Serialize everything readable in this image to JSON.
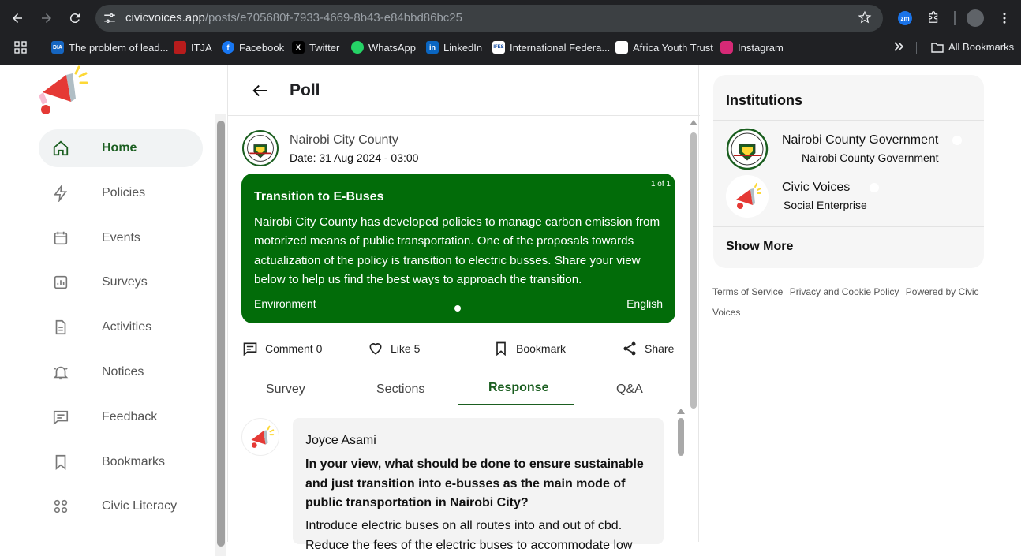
{
  "browser": {
    "url_host": "civicvoices.app",
    "url_path": "/posts/e705680f-7933-4669-8b43-e84bbd86bc25",
    "extension_zm": "zm",
    "bookmarks": [
      {
        "label": "The problem of lead...",
        "icon": "DIA"
      },
      {
        "label": "ITJA",
        "icon": ""
      },
      {
        "label": "Facebook",
        "icon": "f"
      },
      {
        "label": "Twitter",
        "icon": "X"
      },
      {
        "label": "WhatsApp",
        "icon": ""
      },
      {
        "label": "LinkedIn",
        "icon": "in"
      },
      {
        "label": "International Federa...",
        "icon": "IFES"
      },
      {
        "label": "Africa Youth Trust",
        "icon": ""
      },
      {
        "label": "Instagram",
        "icon": ""
      }
    ],
    "all_bookmarks": "All Bookmarks"
  },
  "sidebar": {
    "items": [
      {
        "label": "Home",
        "icon": "home-icon"
      },
      {
        "label": "Policies",
        "icon": "lightning-icon"
      },
      {
        "label": "Events",
        "icon": "calendar-icon"
      },
      {
        "label": "Surveys",
        "icon": "chart-icon"
      },
      {
        "label": "Activities",
        "icon": "document-icon"
      },
      {
        "label": "Notices",
        "icon": "bell-icon"
      },
      {
        "label": "Feedback",
        "icon": "message-icon"
      },
      {
        "label": "Bookmarks",
        "icon": "bookmark-icon"
      },
      {
        "label": "Civic Literacy",
        "icon": "grid-icon"
      }
    ]
  },
  "main": {
    "title": "Poll",
    "post": {
      "author": "Nairobi City County",
      "date": "Date: 31 Aug 2024 - 03:00",
      "pager": "1 of 1",
      "title": "Transition to E-Buses",
      "body": "Nairobi City County has developed policies to manage carbon emission from motorized means of public transportation. One of the proposals towards actualization of the policy is transition to electric busses. Share your view below to help us find the best ways to approach the transition.",
      "category": "Environment",
      "language": "English"
    },
    "actions": {
      "comment": "Comment 0",
      "like": "Like 5",
      "bookmark": "Bookmark",
      "share": "Share"
    },
    "tabs": [
      "Survey",
      "Sections",
      "Response",
      "Q&A"
    ],
    "active_tab": "Response",
    "response": {
      "name": "Joyce Asami",
      "question": "In your view, what should be done to ensure sustainable and just transition into e-busses as the main mode of public transportation in Nairobi City?",
      "answer": "Introduce electric buses on all routes into and out of cbd. Reduce the fees of the electric buses to accommodate low"
    }
  },
  "institutions": {
    "title": "Institutions",
    "items": [
      {
        "name": "Nairobi County Government",
        "subtitle": "Nairobi County Government"
      },
      {
        "name": "Civic Voices",
        "subtitle": "Social Enterprise"
      }
    ],
    "show_more": "Show More"
  },
  "footer": {
    "links": [
      "Terms of Service",
      "Privacy and Cookie Policy",
      "Powered by Civic Voices"
    ]
  },
  "colors": {
    "brand_green": "#026c09",
    "active_green": "#1b5e20",
    "chrome_bg": "#202124"
  }
}
